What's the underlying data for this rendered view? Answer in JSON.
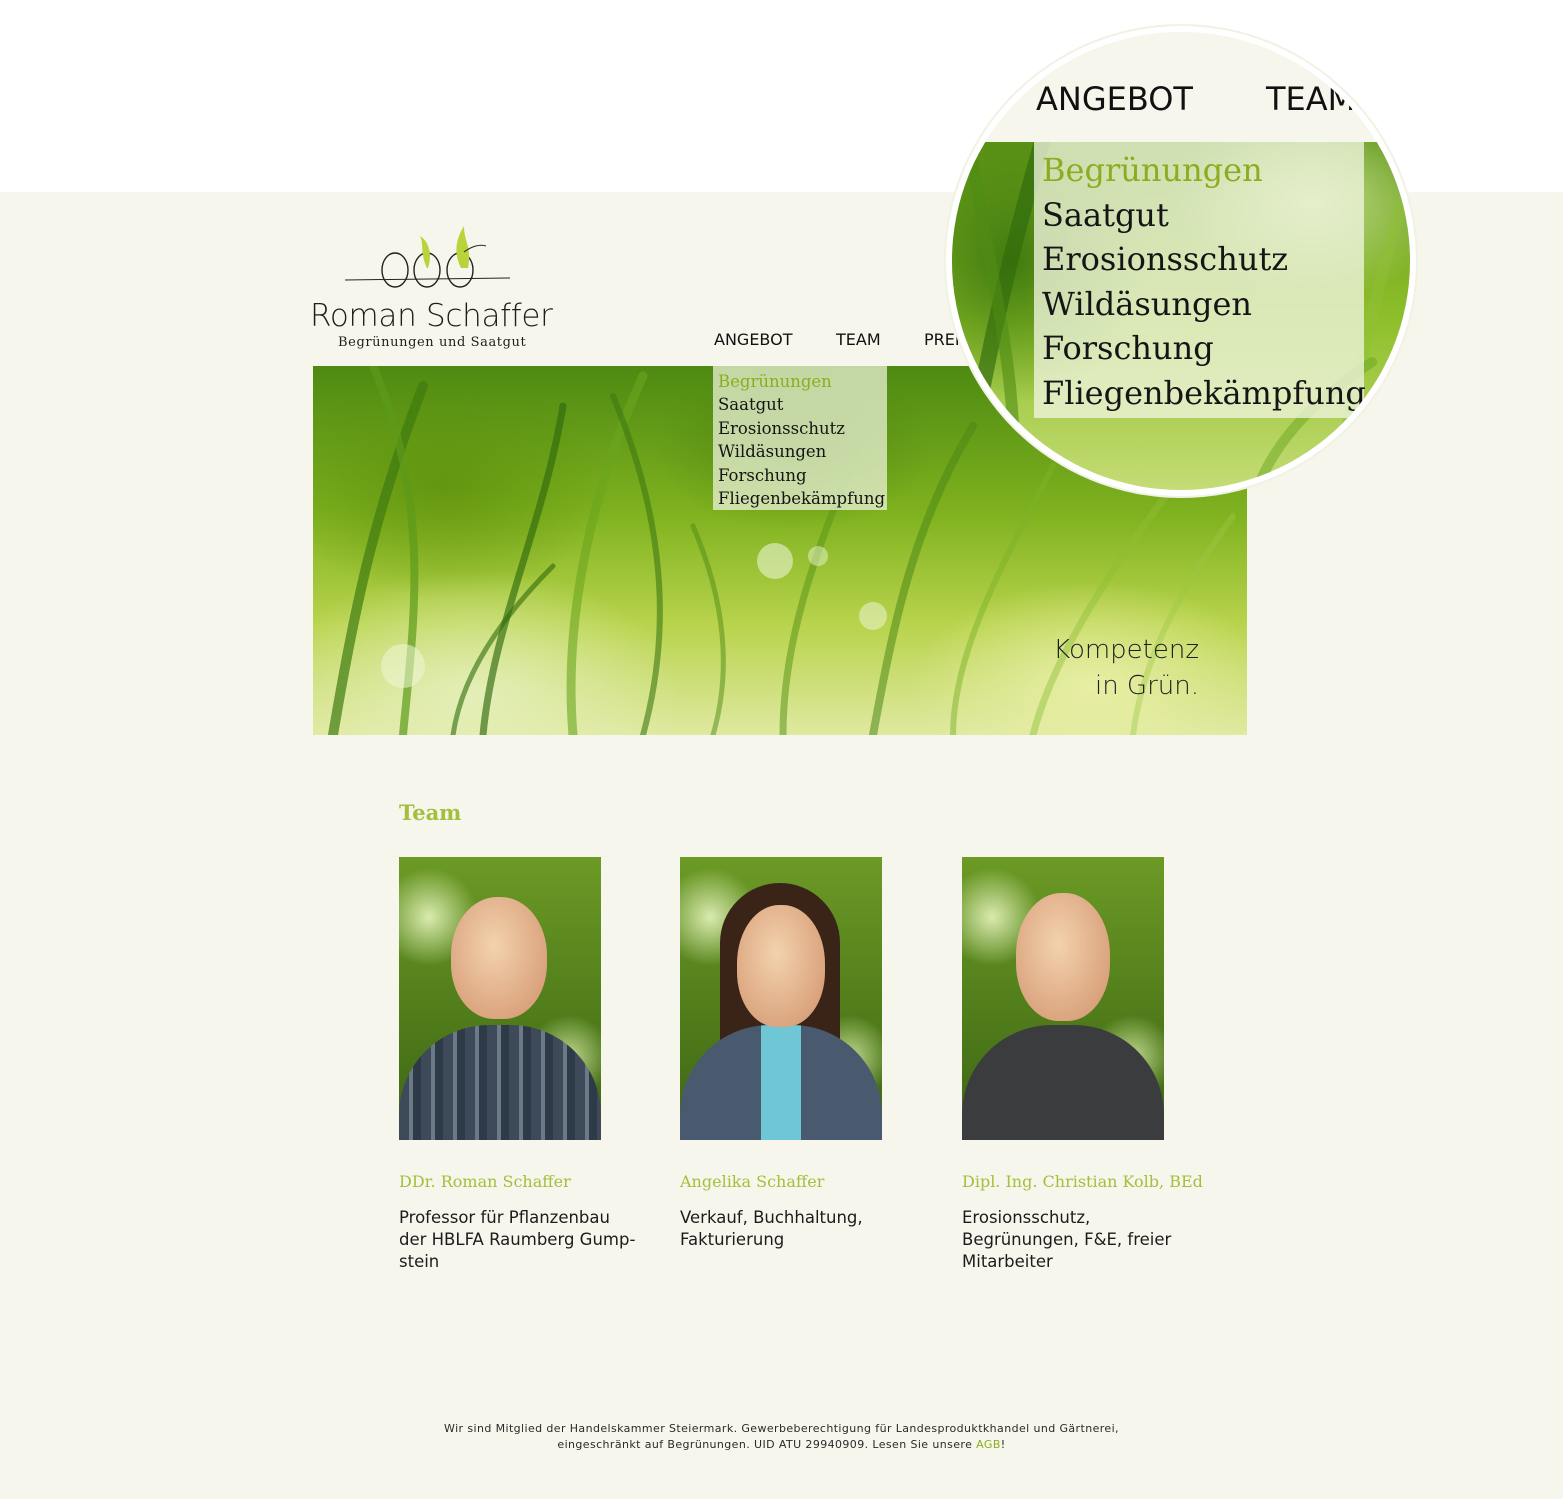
{
  "logo": {
    "name": "Roman Schaffer",
    "tagline": "Begrünungen und Saatgut"
  },
  "nav": {
    "items": [
      "ANGEBOT",
      "TEAM",
      "PREI"
    ]
  },
  "dropdown": {
    "active": "Begrünungen",
    "items": [
      "Begrünungen",
      "Saatgut",
      "Erosionsschutz",
      "Wildäsungen",
      "Forschung",
      "Fliegenbekämpfung"
    ]
  },
  "magnifier": {
    "nav": [
      "ANGEBOT",
      "TEAM"
    ],
    "items": [
      "Begrünungen",
      "Saatgut",
      "Erosionsschutz",
      "Wildäsungen",
      "Forschung",
      "Fliegenbekämpfung"
    ]
  },
  "hero": {
    "slogan_line1": "Kompetenz",
    "slogan_line2": "in Grün."
  },
  "team": {
    "heading": "Team",
    "members": [
      {
        "name": "DDr. Roman Schaffer",
        "role": "Professor für Pflanzenbau der HBLFA Raumberg Gump-stein"
      },
      {
        "name": "Angelika Schaffer",
        "role": "Verkauf, Buchhaltung, Fakturierung"
      },
      {
        "name": "Dipl. Ing. Christian Kolb, BEd",
        "role": "Erosionsschutz, Begrünungen, F&E, freier Mitarbeiter"
      }
    ]
  },
  "footer": {
    "line1": "Wir sind Mitglied der Handelskammer Steiermark. Gewerbeberechtigung für Landesproduktkhandel und Gärtnerei,",
    "line2_prefix": "eingeschränkt auf Begrünungen. UID ATU 29940909. Lesen Sie unsere ",
    "agb_link": "AGB",
    "line2_suffix": "!"
  },
  "colors": {
    "accent_green": "#a3bf3c",
    "page_background": "#f6f6ec"
  }
}
